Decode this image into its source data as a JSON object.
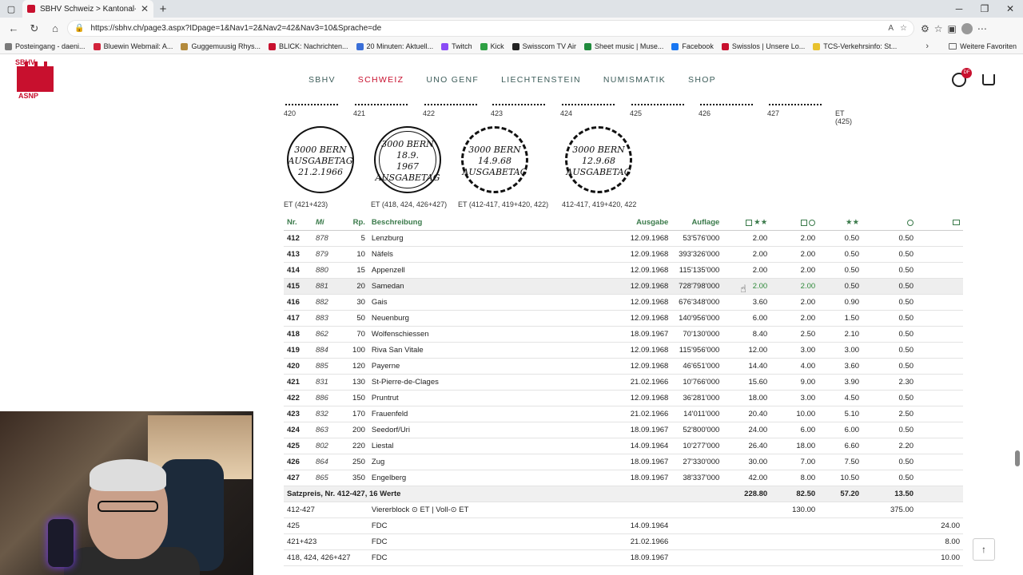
{
  "browser": {
    "tab_title": "SBHV Schweiz > Kantonal- und F...",
    "url": "https://sbhv.ch/page3.aspx?IDpage=1&Nav1=2&Nav2=42&Nav3=10&Sprache=de",
    "bookmarks": [
      "Posteingang - daeni...",
      "Bluewin Webmail: A...",
      "Guggemuusig Rhys...",
      "BLICK: Nachrichten...",
      "20 Minuten: Aktuell...",
      "Twitch",
      "Kick",
      "Swisscom TV Air",
      "Sheet music | Muse...",
      "Facebook",
      "Swisslos | Unsere Lo...",
      "TCS-Verkehrsinfo: St..."
    ],
    "bookmark_colors": [
      "#7a7a7a",
      "#d2233b",
      "#b38a3c",
      "#c8102e",
      "#3a6fd8",
      "#8a4bf6",
      "#2ea043",
      "#222222",
      "#1f8a3c",
      "#1877f2",
      "#c8102e",
      "#e8c22e"
    ],
    "other_favorites": "Weitere Favoriten"
  },
  "site": {
    "logo_top": "SBHV",
    "logo_bottom": "ASNP",
    "nav": [
      "SBHV",
      "SCHWEIZ",
      "UNO GENF",
      "LIECHTENSTEIN",
      "NUMISMATIK",
      "SHOP"
    ],
    "active_nav": "SCHWEIZ",
    "user_badge": "DF"
  },
  "stamps": {
    "numbers": [
      "420",
      "421",
      "422",
      "423",
      "424",
      "425",
      "426",
      "427",
      "ET (425)"
    ],
    "cancellations": [
      {
        "lines": [
          "3000 BERN",
          "AUSGABETAG",
          "21.2.1966"
        ],
        "label": "ET (421+423)"
      },
      {
        "lines": [
          "3000 BERN",
          "18.9.",
          "1967",
          "AUSGABETAG"
        ],
        "label": "ET (418, 424, 426+427)"
      },
      {
        "lines": [
          "3000 BERN",
          "14.9.68",
          "AUSGABETAG"
        ],
        "label": "ET (412-417, 419+420, 422)"
      },
      {
        "lines": [
          "3000 BERN",
          "12.9.68",
          "AUSGABETAG"
        ],
        "label": "412-417, 419+420, 422"
      }
    ]
  },
  "table": {
    "headers": {
      "nr": "Nr.",
      "mi": "Mi",
      "rp": "Rp.",
      "desc": "Beschreibung",
      "ausgabe": "Ausgabe",
      "auflage": "Auflage",
      "c1": "★★",
      "c3": "★★"
    },
    "rows": [
      {
        "nr": "412",
        "mi": "878",
        "rp": "5",
        "desc": "Lenzburg",
        "date": "12.09.1968",
        "auflage": "53'576'000",
        "a": "2.00",
        "b": "2.00",
        "c": "0.50",
        "d": "0.50"
      },
      {
        "nr": "413",
        "mi": "879",
        "rp": "10",
        "desc": "Näfels",
        "date": "12.09.1968",
        "auflage": "393'326'000",
        "a": "2.00",
        "b": "2.00",
        "c": "0.50",
        "d": "0.50"
      },
      {
        "nr": "414",
        "mi": "880",
        "rp": "15",
        "desc": "Appenzell",
        "date": "12.09.1968",
        "auflage": "115'135'000",
        "a": "2.00",
        "b": "2.00",
        "c": "0.50",
        "d": "0.50"
      },
      {
        "nr": "415",
        "mi": "881",
        "rp": "20",
        "desc": "Samedan",
        "date": "12.09.1968",
        "auflage": "728'798'000",
        "a": "2.00",
        "b": "2.00",
        "c": "0.50",
        "d": "0.50"
      },
      {
        "nr": "416",
        "mi": "882",
        "rp": "30",
        "desc": "Gais",
        "date": "12.09.1968",
        "auflage": "676'348'000",
        "a": "3.60",
        "b": "2.00",
        "c": "0.90",
        "d": "0.50"
      },
      {
        "nr": "417",
        "mi": "883",
        "rp": "50",
        "desc": "Neuenburg",
        "date": "12.09.1968",
        "auflage": "140'956'000",
        "a": "6.00",
        "b": "2.00",
        "c": "1.50",
        "d": "0.50"
      },
      {
        "nr": "418",
        "mi": "862",
        "rp": "70",
        "desc": "Wolfenschiessen",
        "date": "18.09.1967",
        "auflage": "70'130'000",
        "a": "8.40",
        "b": "2.50",
        "c": "2.10",
        "d": "0.50"
      },
      {
        "nr": "419",
        "mi": "884",
        "rp": "100",
        "desc": "Riva San Vitale",
        "date": "12.09.1968",
        "auflage": "115'956'000",
        "a": "12.00",
        "b": "3.00",
        "c": "3.00",
        "d": "0.50"
      },
      {
        "nr": "420",
        "mi": "885",
        "rp": "120",
        "desc": "Payerne",
        "date": "12.09.1968",
        "auflage": "46'651'000",
        "a": "14.40",
        "b": "4.00",
        "c": "3.60",
        "d": "0.50"
      },
      {
        "nr": "421",
        "mi": "831",
        "rp": "130",
        "desc": "St-Pierre-de-Clages",
        "date": "21.02.1966",
        "auflage": "10'766'000",
        "a": "15.60",
        "b": "9.00",
        "c": "3.90",
        "d": "2.30"
      },
      {
        "nr": "422",
        "mi": "886",
        "rp": "150",
        "desc": "Pruntrut",
        "date": "12.09.1968",
        "auflage": "36'281'000",
        "a": "18.00",
        "b": "3.00",
        "c": "4.50",
        "d": "0.50"
      },
      {
        "nr": "423",
        "mi": "832",
        "rp": "170",
        "desc": "Frauenfeld",
        "date": "21.02.1966",
        "auflage": "14'011'000",
        "a": "20.40",
        "b": "10.00",
        "c": "5.10",
        "d": "2.50"
      },
      {
        "nr": "424",
        "mi": "863",
        "rp": "200",
        "desc": "Seedorf/Uri",
        "date": "18.09.1967",
        "auflage": "52'800'000",
        "a": "24.00",
        "b": "6.00",
        "c": "6.00",
        "d": "0.50"
      },
      {
        "nr": "425",
        "mi": "802",
        "rp": "220",
        "desc": "Liestal",
        "date": "14.09.1964",
        "auflage": "10'277'000",
        "a": "26.40",
        "b": "18.00",
        "c": "6.60",
        "d": "2.20"
      },
      {
        "nr": "426",
        "mi": "864",
        "rp": "250",
        "desc": "Zug",
        "date": "18.09.1967",
        "auflage": "27'330'000",
        "a": "30.00",
        "b": "7.00",
        "c": "7.50",
        "d": "0.50"
      },
      {
        "nr": "427",
        "mi": "865",
        "rp": "350",
        "desc": "Engelberg",
        "date": "18.09.1967",
        "auflage": "38'337'000",
        "a": "42.00",
        "b": "8.00",
        "c": "10.50",
        "d": "0.50"
      }
    ],
    "summary": {
      "label": "Satzpreis, Nr. 412-427, 16 Werte",
      "a": "228.80",
      "b": "82.50",
      "c": "57.20",
      "d": "13.50"
    },
    "extras": [
      {
        "nr": "412-427",
        "desc": "Viererblock ⊙ ET | Voll-⊙ ET",
        "date": "",
        "b": "130.00",
        "d": "375.00",
        "e": ""
      },
      {
        "nr": "425",
        "desc": "FDC",
        "date": "14.09.1964",
        "b": "",
        "d": "",
        "e": "24.00"
      },
      {
        "nr": "421+423",
        "desc": "FDC",
        "date": "21.02.1966",
        "b": "",
        "d": "",
        "e": "8.00"
      },
      {
        "nr": "418, 424, 426+427",
        "desc": "FDC",
        "date": "18.09.1967",
        "b": "",
        "d": "",
        "e": "10.00"
      }
    ]
  }
}
